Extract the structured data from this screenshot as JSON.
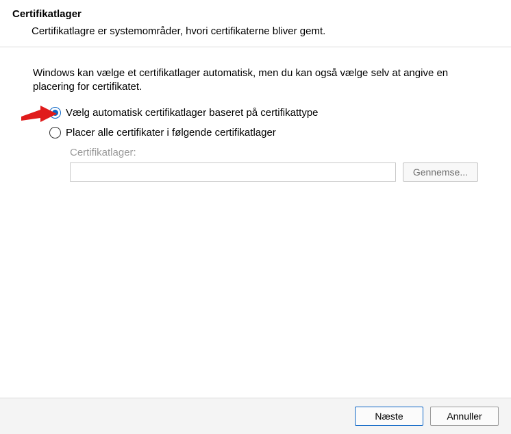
{
  "header": {
    "title": "Certifikatlager",
    "subtitle": "Certifikatlagre er systemområder, hvori certifikaterne bliver gemt."
  },
  "instruction": "Windows kan vælge et certifikatlager automatisk, men du kan også vælge selv at angive en placering for certifikatet.",
  "radio": {
    "auto": "Vælg automatisk certifikatlager baseret på certifikattype",
    "manual": "Placer alle certifikater i følgende certifikatlager"
  },
  "store": {
    "label": "Certifikatlager:",
    "value": "",
    "browse": "Gennemse..."
  },
  "footer": {
    "next": "Næste",
    "cancel": "Annuller"
  }
}
